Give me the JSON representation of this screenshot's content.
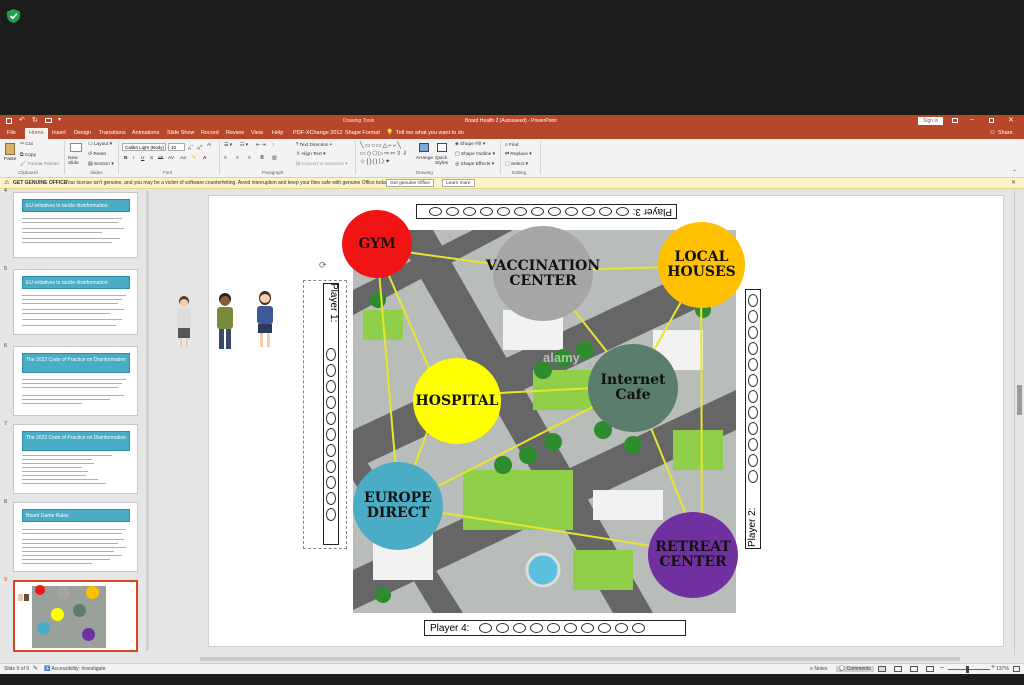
{
  "app": {
    "title": "Board Health 2 (Autosaved) - PowerPoint",
    "context_tab_group": "Drawing Tools",
    "signin": "Sign in",
    "share": "Share"
  },
  "tabs": [
    "File",
    "Home",
    "Insert",
    "Design",
    "Transitions",
    "Animations",
    "Slide Show",
    "Record",
    "Review",
    "View",
    "Help",
    "PDF-XChange 2012",
    "Shape Format"
  ],
  "tell_me": "Tell me what you want to do",
  "ribbon": {
    "clipboard": {
      "paste": "Paste",
      "cut": "Cut",
      "copy": "Copy",
      "format_painter": "Format Painter",
      "group": "Clipboard"
    },
    "slides": {
      "new_slide": "New Slide",
      "layout": "Layout",
      "reset": "Reset",
      "section": "Section",
      "group": "Slides"
    },
    "font": {
      "name": "Calibri Light (Body)",
      "size": "10",
      "group": "Font"
    },
    "paragraph": {
      "text_direction": "Text Direction",
      "align_text": "Align Text",
      "smartart": "Convert to SmartArt",
      "group": "Paragraph"
    },
    "drawing": {
      "arrange": "Arrange",
      "quick_styles": "Quick Styles",
      "shape_fill": "Shape Fill",
      "shape_outline": "Shape Outline",
      "shape_effects": "Shape Effects",
      "group": "Drawing"
    },
    "editing": {
      "find": "Find",
      "replace": "Replace",
      "select": "Select",
      "group": "Editing"
    }
  },
  "warning": {
    "title": "GET GENUINE OFFICE",
    "message": "Your license isn't genuine, and you may be a victim of software counterfeiting. Avoid interruption and keep your files safe with genuine Office today.",
    "btn_genuine": "Get genuine Office",
    "btn_learn": "Learn more"
  },
  "thumbnails": [
    {
      "num": "4",
      "title": "EU initiatives to tackle disinformation:"
    },
    {
      "num": "5",
      "title": "EU initiatives to tackle disinformation:"
    },
    {
      "num": "6",
      "title": "The 2022 Code of Practice on Disinformation"
    },
    {
      "num": "7",
      "title": "The 2022 Code of Practice on Disinformation"
    },
    {
      "num": "8",
      "title": "Board Game Rules"
    },
    {
      "num": "9",
      "title": ""
    }
  ],
  "slide": {
    "player1": "Player 1:",
    "player2": "Player 2:",
    "player3": "Player 3:",
    "player4": "Player 4:",
    "nodes": {
      "gym": {
        "label": "GYM",
        "color": "#f01414"
      },
      "vaccination": {
        "label": "VACCINATION CENTER",
        "color": "#a6a6a6"
      },
      "local_houses": {
        "label": "LOCAL HOUSES",
        "color": "#ffc000"
      },
      "internet_cafe": {
        "label": "Internet Cafe",
        "color": "#5a7d6c"
      },
      "hospital": {
        "label": "HOSPITAL",
        "color": "#ffff00"
      },
      "europe_direct": {
        "label": "EUROPE DIRECT",
        "color": "#4bacc6"
      },
      "retreat": {
        "label": "RETREAT CENTER",
        "color": "#7030a0"
      }
    },
    "watermark": "alamy"
  },
  "status": {
    "slide_info": "Slide 9 of 9",
    "accessibility": "Accessibility: Investigate",
    "notes": "Notes",
    "comments": "Comments",
    "zoom": "137%"
  },
  "colors": {
    "accent": "#b7472a",
    "connector": "#e6e62e"
  }
}
